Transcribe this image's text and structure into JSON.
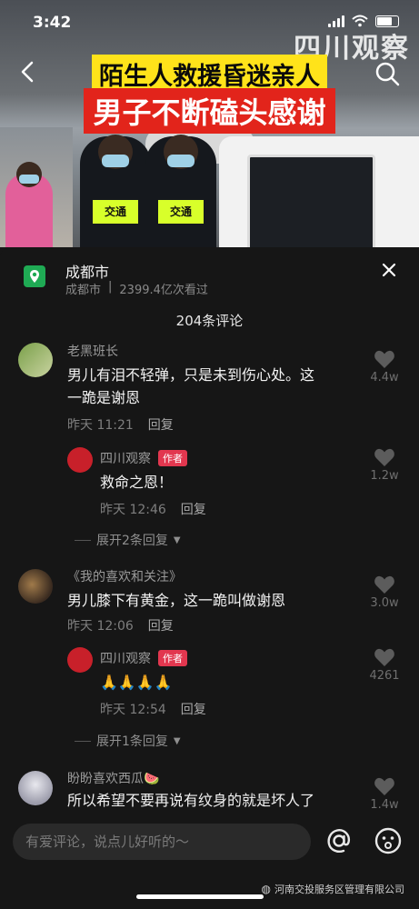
{
  "status_bar": {
    "time": "3:42"
  },
  "video": {
    "brand": "四川观察",
    "headline_line1": "陌生人救援昏迷亲人",
    "headline_line2": "男子不断磕头感谢",
    "vest_text": "交通"
  },
  "panel": {
    "location_title": "成都市",
    "location_sub_city": "成都市",
    "location_sub_sep": "|",
    "location_sub_views": "2399.4亿次看过",
    "comment_count_title": "204条评论"
  },
  "comments": [
    {
      "user": "老黑班长",
      "text_line1": "男儿有泪不轻弹，只是未到伤心处。这",
      "text_line2": "一跪是谢恩",
      "time": "昨天 11:21",
      "reply_label": "回复",
      "likes": "4.4w",
      "reply": {
        "user": "四川观察",
        "author_tag": "作者",
        "text": "救命之恩！",
        "time": "昨天 12:46",
        "reply_label": "回复",
        "likes": "1.2w"
      },
      "expand_label": "展开2条回复"
    },
    {
      "user": "《我的喜欢和关注》",
      "text_line1": "男儿膝下有黄金，这一跪叫做谢恩",
      "time": "昨天 12:06",
      "reply_label": "回复",
      "likes": "3.0w",
      "reply": {
        "user": "四川观察",
        "author_tag": "作者",
        "text": "🙏🙏🙏🙏",
        "time": "昨天 12:54",
        "reply_label": "回复",
        "likes": "4261"
      },
      "expand_label": "展开1条回复"
    },
    {
      "user": "盼盼喜欢西瓜🍉",
      "text_line1": "所以希望不要再说有纹身的就是坏人了",
      "likes": "1.4w"
    }
  ],
  "input": {
    "placeholder": "有爱评论，说点儿好听的～"
  },
  "watermark": "河南交投服务区管理有限公司",
  "colors": {
    "accent_yellow": "#ffe31a",
    "accent_red": "#e2241b",
    "author_tag": "#e2374f",
    "location_green": "#1faa54"
  }
}
